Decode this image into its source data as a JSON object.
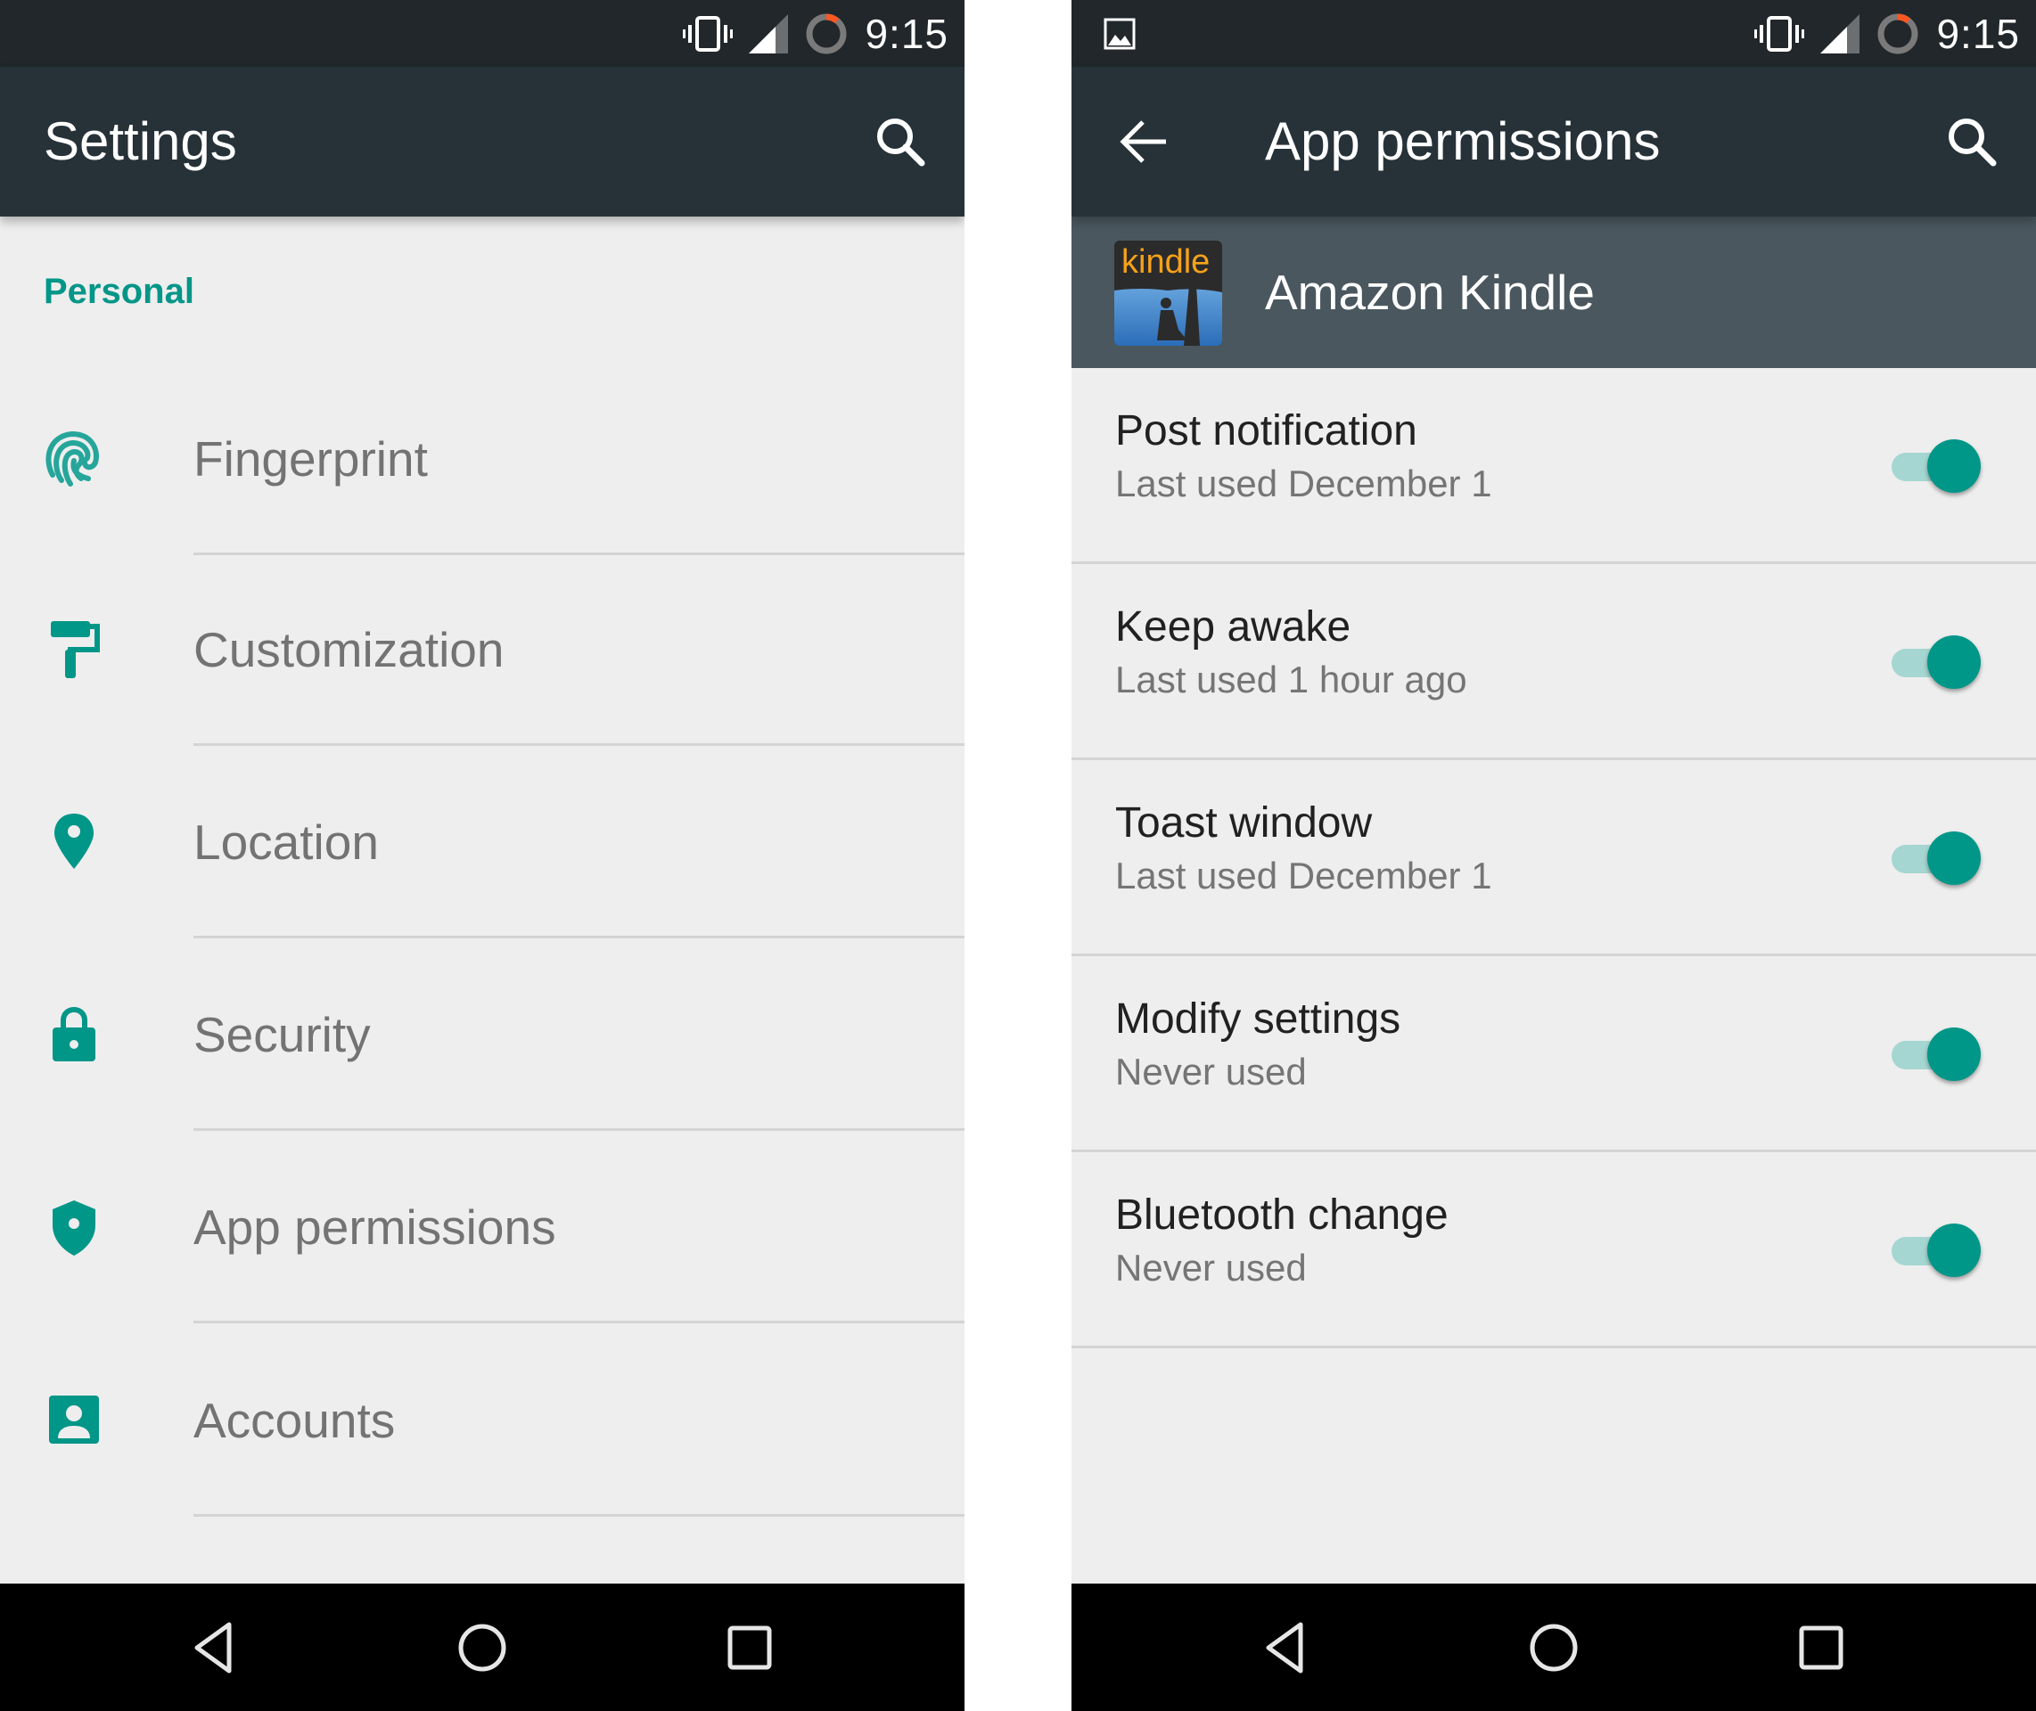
{
  "colors": {
    "accent": "#009688",
    "status_bar": "#21272b",
    "app_bar": "#263238",
    "app_header": "#4a575e",
    "background": "#eeeeee",
    "battery_arc": "#ff5722"
  },
  "left_screen": {
    "status_bar": {
      "time": "9:15",
      "icons": [
        "vibrate-icon",
        "signal-icon",
        "battery-saver-icon"
      ]
    },
    "app_bar": {
      "title": "Settings",
      "search_icon": "search-icon"
    },
    "section_header": "Personal",
    "items": [
      {
        "label": "Fingerprint",
        "icon": "fingerprint-icon"
      },
      {
        "label": "Customization",
        "icon": "paint-roller-icon"
      },
      {
        "label": "Location",
        "icon": "location-pin-icon"
      },
      {
        "label": "Security",
        "icon": "lock-icon"
      },
      {
        "label": "App permissions",
        "icon": "shield-icon"
      },
      {
        "label": "Accounts",
        "icon": "account-box-icon"
      }
    ],
    "nav_bar": [
      "back",
      "home",
      "recents"
    ]
  },
  "right_screen": {
    "status_bar": {
      "time": "9:15",
      "icons": [
        "image-notification-icon",
        "vibrate-icon",
        "signal-icon",
        "battery-saver-icon"
      ]
    },
    "app_bar": {
      "title": "App permissions",
      "back_icon": "arrow-back-icon",
      "search_icon": "search-icon"
    },
    "app": {
      "name": "Amazon Kindle",
      "icon_text": "kindle"
    },
    "permissions": [
      {
        "title": "Post notification",
        "subtitle": "Last used December 1",
        "enabled": true
      },
      {
        "title": "Keep awake",
        "subtitle": "Last used 1 hour ago",
        "enabled": true
      },
      {
        "title": "Toast window",
        "subtitle": "Last used December 1",
        "enabled": true
      },
      {
        "title": "Modify settings",
        "subtitle": "Never used",
        "enabled": true
      },
      {
        "title": "Bluetooth change",
        "subtitle": "Never used",
        "enabled": true
      }
    ],
    "nav_bar": [
      "back",
      "home",
      "recents"
    ]
  }
}
